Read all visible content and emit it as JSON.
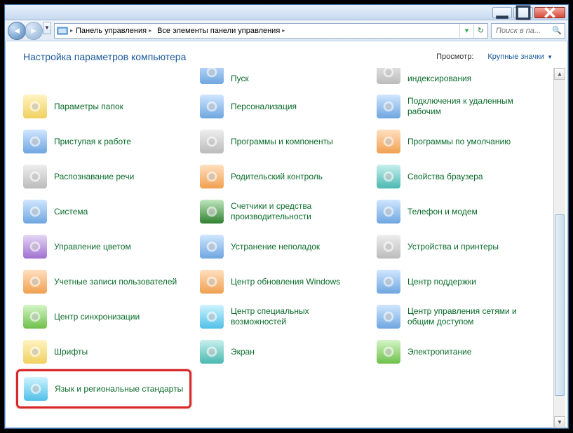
{
  "window": {
    "minimize_title": "Свернуть",
    "maximize_title": "Развернуть",
    "close_title": "Закрыть"
  },
  "breadcrumb": {
    "seg1": "Панель управления",
    "seg2": "Все элементы панели управления"
  },
  "search": {
    "placeholder": "Поиск в па..."
  },
  "body": {
    "title": "Настройка параметров компьютера",
    "view_label": "Просмотр:",
    "view_value": "Крупные значки"
  },
  "items": [
    {
      "label": "Пуск",
      "icon": "start-icon",
      "cls": "ic-blue",
      "partial": true
    },
    {
      "label": "индексирования",
      "icon": "index-icon",
      "cls": "ic-grey",
      "partial": true
    },
    {
      "label": "Параметры папок",
      "icon": "folder-options-icon",
      "cls": "ic-yellow"
    },
    {
      "label": "Персонализация",
      "icon": "personalization-icon",
      "cls": "ic-blue"
    },
    {
      "label": "Подключения к удаленным рабочим",
      "icon": "remote-desktop-icon",
      "cls": "ic-blue"
    },
    {
      "label": "Приступая к работе",
      "icon": "getting-started-icon",
      "cls": "ic-blue"
    },
    {
      "label": "Программы и компоненты",
      "icon": "programs-icon",
      "cls": "ic-grey"
    },
    {
      "label": "Программы по умолчанию",
      "icon": "default-programs-icon",
      "cls": "ic-orange"
    },
    {
      "label": "Распознавание речи",
      "icon": "speech-icon",
      "cls": "ic-grey"
    },
    {
      "label": "Родительский контроль",
      "icon": "parental-icon",
      "cls": "ic-orange"
    },
    {
      "label": "Свойства браузера",
      "icon": "internet-options-icon",
      "cls": "ic-teal"
    },
    {
      "label": "Система",
      "icon": "system-icon",
      "cls": "ic-blue"
    },
    {
      "label": "Счетчики и средства производительности",
      "icon": "performance-icon",
      "cls": "ic-dgreen"
    },
    {
      "label": "Телефон и модем",
      "icon": "phone-modem-icon",
      "cls": "ic-blue"
    },
    {
      "label": "Управление цветом",
      "icon": "color-mgmt-icon",
      "cls": "ic-purple"
    },
    {
      "label": "Устранение неполадок",
      "icon": "troubleshoot-icon",
      "cls": "ic-blue"
    },
    {
      "label": "Устройства и принтеры",
      "icon": "devices-printers-icon",
      "cls": "ic-grey"
    },
    {
      "label": "Учетные записи пользователей",
      "icon": "user-accounts-icon",
      "cls": "ic-orange"
    },
    {
      "label": "Центр обновления Windows",
      "icon": "windows-update-icon",
      "cls": "ic-orange"
    },
    {
      "label": "Центр поддержки",
      "icon": "action-center-icon",
      "cls": "ic-blue"
    },
    {
      "label": "Центр синхронизации",
      "icon": "sync-center-icon",
      "cls": "ic-green"
    },
    {
      "label": "Центр специальных возможностей",
      "icon": "ease-access-icon",
      "cls": "ic-cyan"
    },
    {
      "label": "Центр управления сетями и общим доступом",
      "icon": "network-sharing-icon",
      "cls": "ic-blue"
    },
    {
      "label": "Шрифты",
      "icon": "fonts-icon",
      "cls": "ic-yellow"
    },
    {
      "label": "Экран",
      "icon": "display-icon",
      "cls": "ic-teal"
    },
    {
      "label": "Электропитание",
      "icon": "power-icon",
      "cls": "ic-green"
    },
    {
      "label": "Язык и региональные стандарты",
      "icon": "region-language-icon",
      "cls": "ic-cyan",
      "highlighted": true
    }
  ]
}
